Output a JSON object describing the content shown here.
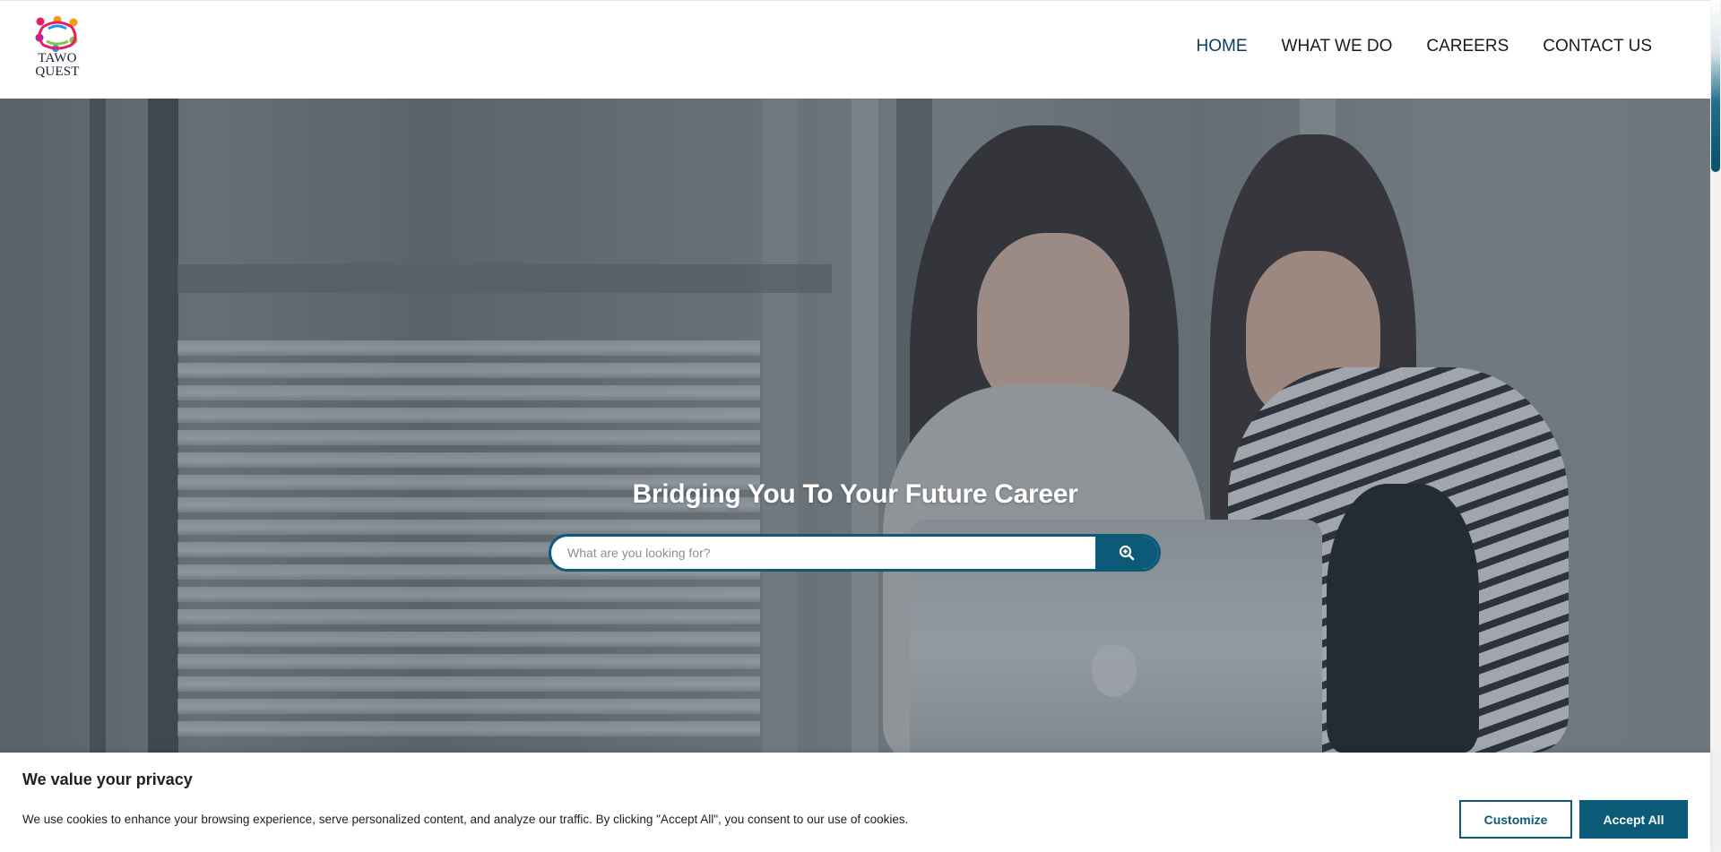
{
  "logo": {
    "line1": "TAWO",
    "line2": "QUEST",
    "colors": [
      "#e91e63",
      "#f39c12",
      "#8bc34a",
      "#2196f3",
      "#9c27b0"
    ]
  },
  "nav": {
    "items": [
      {
        "label": "HOME",
        "active": true
      },
      {
        "label": "WHAT WE DO",
        "active": false
      },
      {
        "label": "CAREERS",
        "active": false
      },
      {
        "label": "CONTACT US",
        "active": false
      }
    ]
  },
  "hero": {
    "title": "Bridging You To Your Future Career",
    "search": {
      "placeholder": "What are you looking for?",
      "value": "",
      "button_icon": "zoom-in-icon"
    }
  },
  "cookie": {
    "title": "We value your privacy",
    "text": "We use cookies to enhance your browsing experience, serve personalized content, and analyze our traffic. By clicking \"Accept All\", you consent to our use of cookies.",
    "customize_label": "Customize",
    "accept_label": "Accept All"
  },
  "theme": {
    "accent": "#0b5a77",
    "nav_active": "#0d3b5c"
  }
}
